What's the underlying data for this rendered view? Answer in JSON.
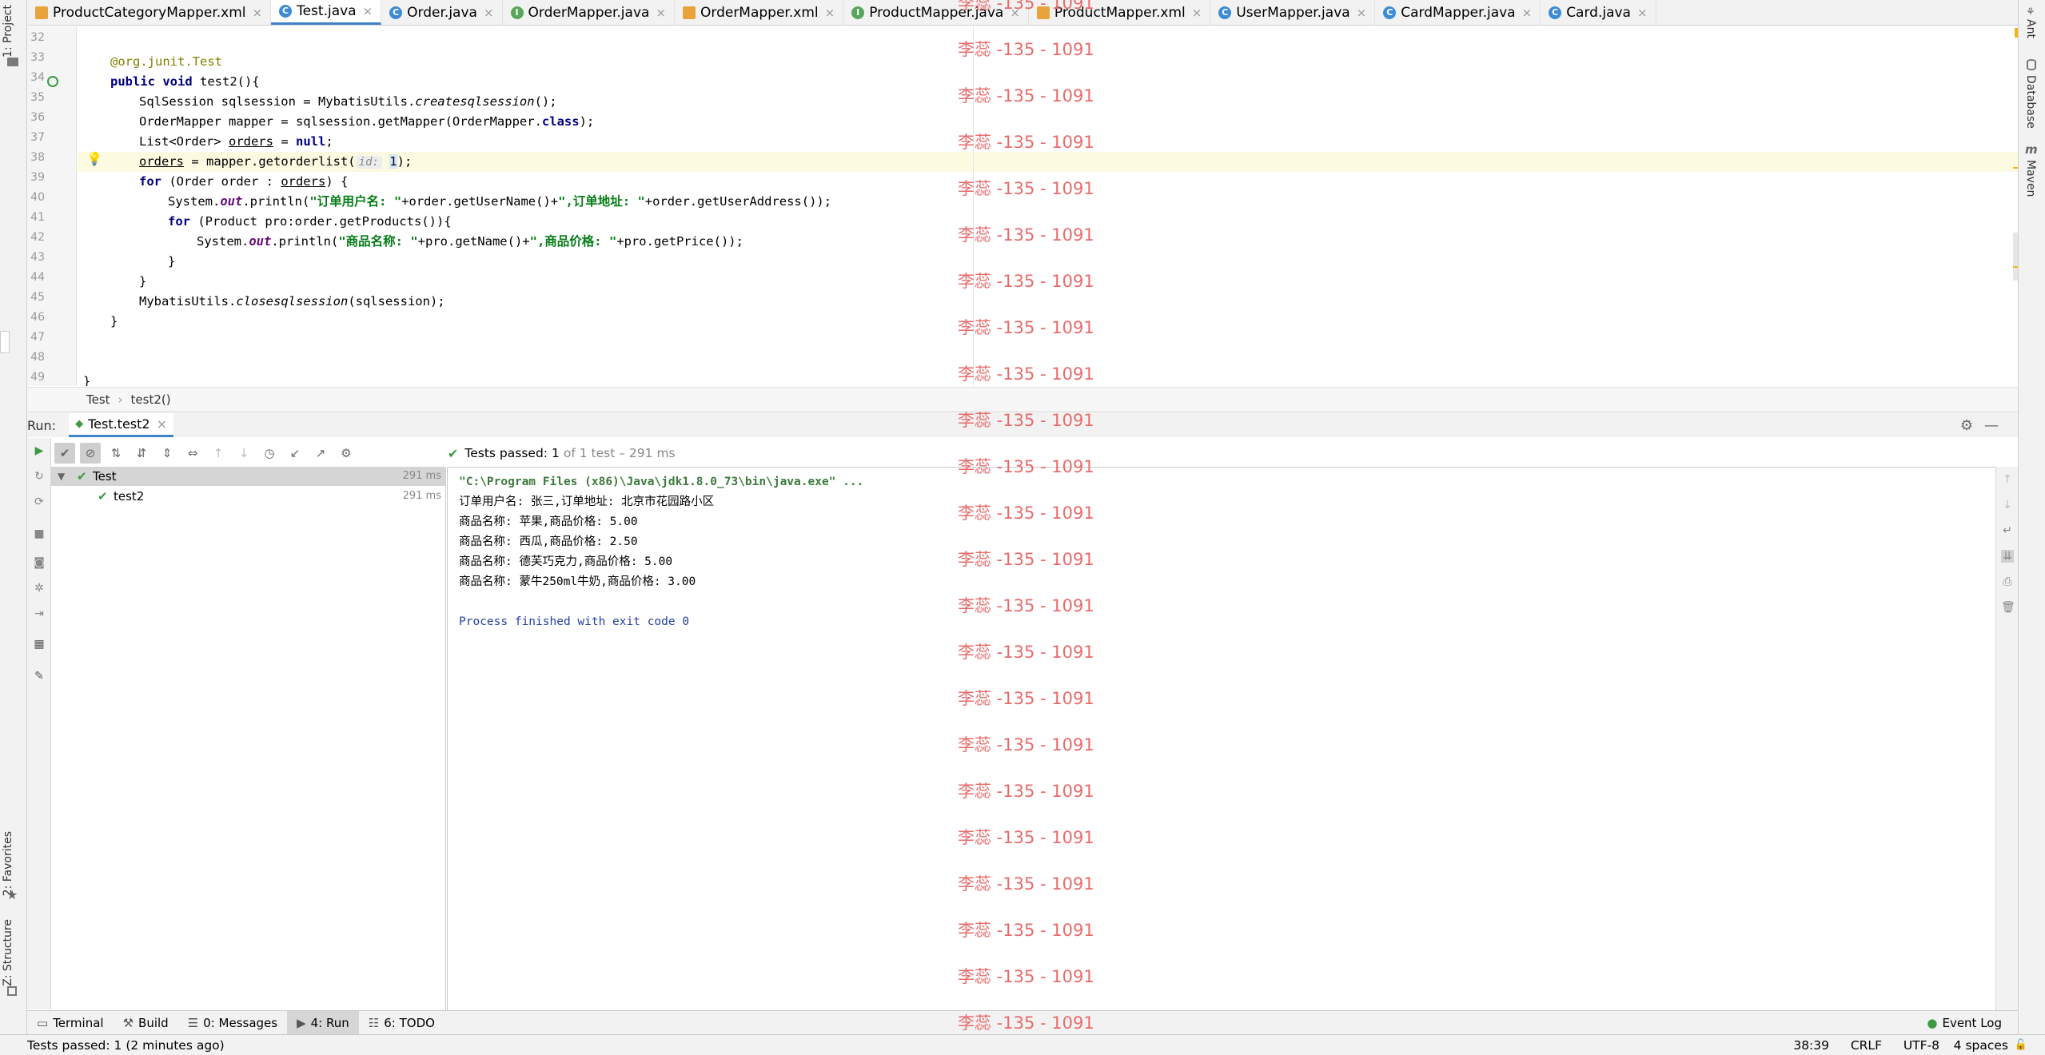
{
  "tabs": [
    {
      "label": "ProductCategoryMapper.xml",
      "icon": "xml-file-icon"
    },
    {
      "label": "Test.java",
      "icon": "class-file-icon",
      "active": true
    },
    {
      "label": "Order.java",
      "icon": "class-file-icon"
    },
    {
      "label": "OrderMapper.java",
      "icon": "interface-file-icon"
    },
    {
      "label": "OrderMapper.xml",
      "icon": "xml-file-icon"
    },
    {
      "label": "ProductMapper.java",
      "icon": "interface-file-icon"
    },
    {
      "label": "ProductMapper.xml",
      "icon": "xml-file-icon"
    },
    {
      "label": "UserMapper.java",
      "icon": "class-file-icon"
    },
    {
      "label": "CardMapper.java",
      "icon": "class-file-icon"
    },
    {
      "label": "Card.java",
      "icon": "class-file-icon"
    }
  ],
  "tab_close": "×",
  "left_stripe": {
    "project": "1: Project",
    "favorites": "2: Favorites",
    "structure": "Z: Structure"
  },
  "right_stripe": {
    "ant": "Ant",
    "database": "Database",
    "maven": "Maven"
  },
  "editor": {
    "line_numbers": [
      "32",
      "33",
      "34",
      "35",
      "36",
      "37",
      "38",
      "39",
      "40",
      "41",
      "42",
      "43",
      "44",
      "45",
      "46",
      "47",
      "48",
      "49"
    ],
    "l33": "@org.junit.Test",
    "l34a": "public void",
    "l34b": " test2(){",
    "l35a": "SqlSession sqlsession = MybatisUtils.",
    "l35b": "createsqlsession",
    "l35c": "();",
    "l36a": "OrderMapper mapper = sqlsession.getMapper(OrderMapper.",
    "l36b": "class",
    "l36c": ");",
    "l37a": "List<Order> ",
    "l37b": "orders",
    "l37c": " = ",
    "l37d": "null",
    "l37e": ";",
    "l38a": "orders",
    "l38b": " = mapper.getorderlist(",
    "l38hint": "id:",
    "l38c": "1",
    "l38d": ");",
    "l39a": "for",
    "l39b": " (Order order : ",
    "l39c": "orders",
    "l39d": ") {",
    "l40a": "System.",
    "l40b": "out",
    "l40c": ".println(",
    "l40d": "\"订单用户名: \"",
    "l40e": "+order.getUserName()+",
    "l40f": "\",订单地址: \"",
    "l40g": "+order.getUserAddress());",
    "l41a": "for",
    "l41b": " (Product pro:order.getProducts()){",
    "l42a": "System.",
    "l42b": "out",
    "l42c": ".println(",
    "l42d": "\"商品名称: \"",
    "l42e": "+pro.getName()+",
    "l42f": "\",商品价格: \"",
    "l42g": "+pro.getPrice());",
    "l43": "}",
    "l44": "}",
    "l45a": "MybatisUtils.",
    "l45b": "closesqlsession",
    "l45c": "(sqlsession);",
    "l46": "}",
    "l49": "}"
  },
  "breadcrumb": {
    "class": "Test",
    "sep": "›",
    "method": "test2()"
  },
  "run": {
    "label": "Run:",
    "config_tab": "Test.test2",
    "status_prefix": "Tests passed:",
    "status_count": "1",
    "status_suffix": "of 1 test – 291 ms",
    "tree": [
      {
        "name": "Test",
        "time": "291 ms"
      },
      {
        "name": "test2",
        "time": "291 ms"
      }
    ],
    "console": [
      "\"C:\\Program Files (x86)\\Java\\jdk1.8.0_73\\bin\\java.exe\" ...",
      "订单用户名: 张三,订单地址: 北京市花园路小区",
      "商品名称: 苹果,商品价格: 5.00",
      "商品名称: 西瓜,商品价格: 2.50",
      "商品名称: 德芙巧克力,商品价格: 5.00",
      "商品名称: 蒙牛250ml牛奶,商品价格: 3.00",
      "",
      "Process finished with exit code 0"
    ]
  },
  "bottom_tabs": [
    {
      "label": "Terminal",
      "icon": "terminal-icon"
    },
    {
      "label": "Build",
      "icon": "hammer-icon"
    },
    {
      "label": "0: Messages",
      "icon": "messages-icon"
    },
    {
      "label": "4: Run",
      "icon": "run-icon",
      "active": true
    },
    {
      "label": "6: TODO",
      "icon": "todo-icon"
    }
  ],
  "event_log": "Event Log",
  "statusbar": {
    "message": "Tests passed: 1 (2 minutes ago)",
    "position": "38:39",
    "line_sep": "CRLF",
    "encoding": "UTF-8",
    "indent": "4 spaces"
  },
  "watermark": "李蕊 -135 - 1091",
  "colors": {
    "accent": "#4083c9",
    "pass": "#3c9a43",
    "watermark": "#e86b6b"
  }
}
